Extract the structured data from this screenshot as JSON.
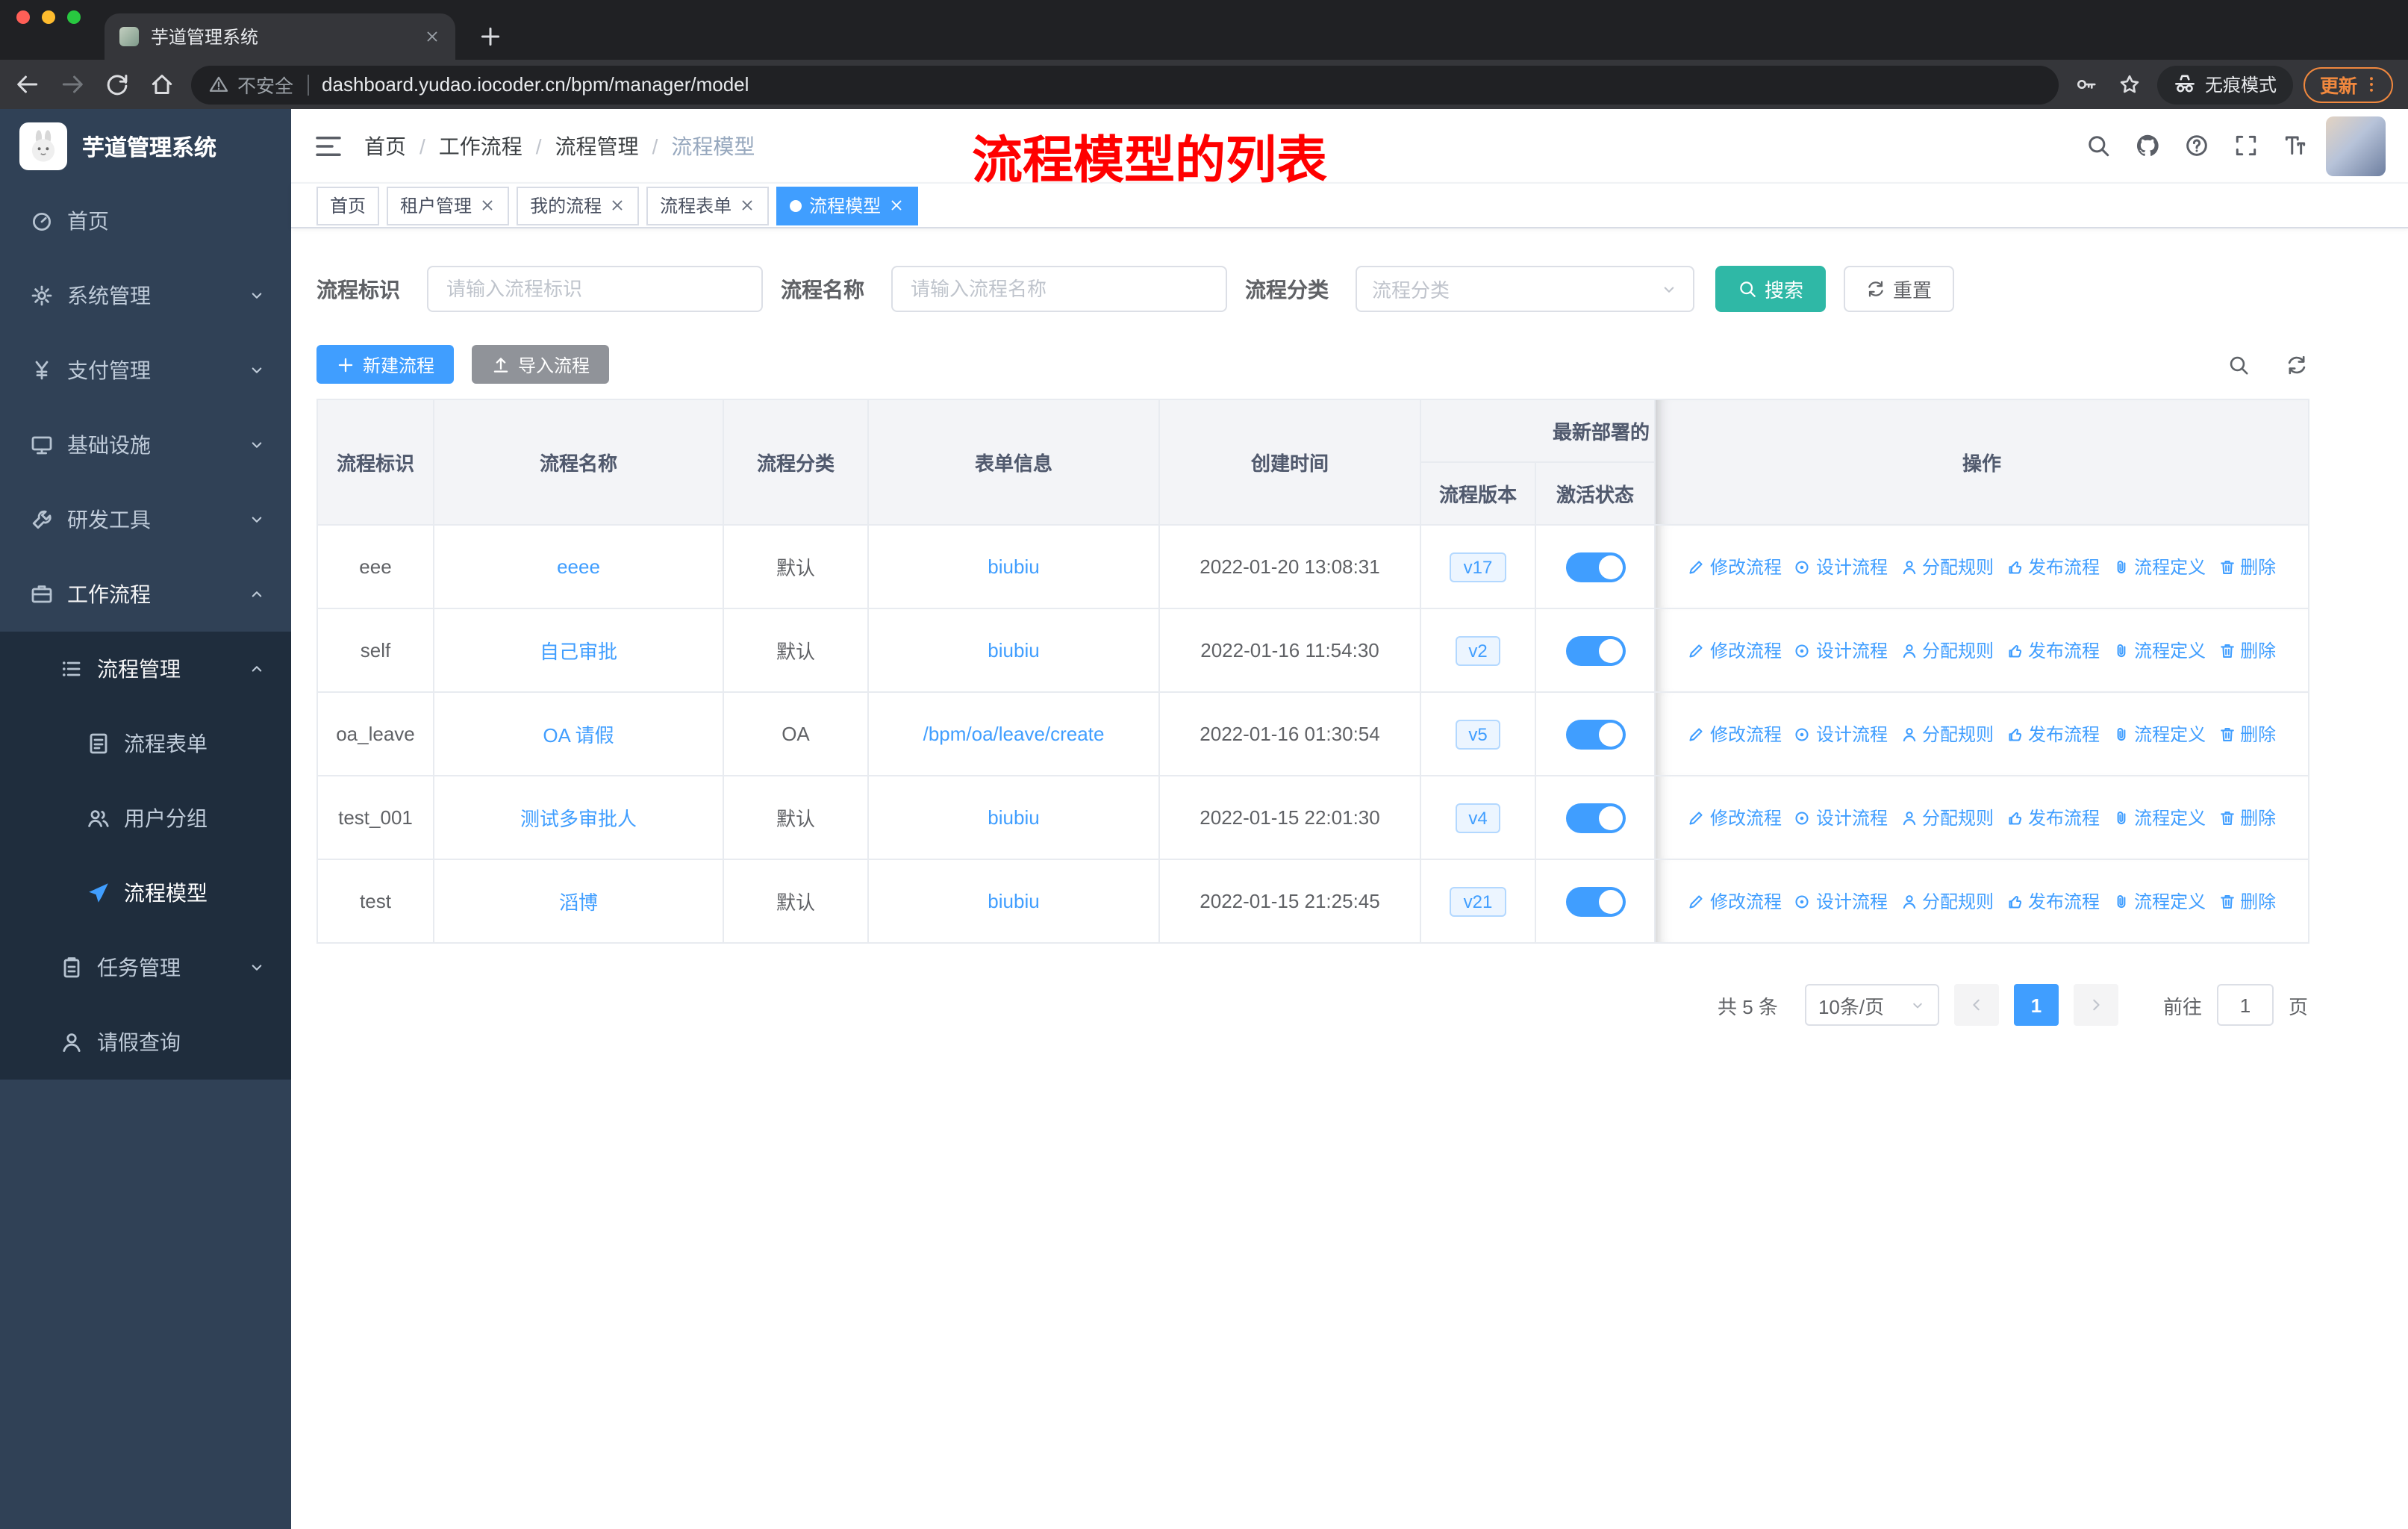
{
  "colors": {
    "primary": "#409eff",
    "search": "#2fb8a6",
    "info": "#909399",
    "sidebar": "#304156",
    "sidebar_dark": "#1f2d3d",
    "annotation": "#ff0000",
    "toggle_on": "#409eff"
  },
  "browser": {
    "tab_title": "芋道管理系统",
    "security_label": "不安全",
    "url": "dashboard.yudao.iocoder.cn/bpm/manager/model",
    "incognito_label": "无痕模式",
    "update_label": "更新",
    "nav_icons": [
      "back-icon",
      "forward-icon",
      "reload-icon",
      "home-icon"
    ],
    "action_icons": [
      "key-icon",
      "star-icon"
    ]
  },
  "sidebar": {
    "title": "芋道管理系统",
    "items": [
      {
        "name": "home",
        "label": "首页",
        "icon": "dashboard-icon",
        "level": 1
      },
      {
        "name": "system-management",
        "label": "系统管理",
        "icon": "gear-icon",
        "level": 1,
        "chevron": "down"
      },
      {
        "name": "payment-management",
        "label": "支付管理",
        "icon": "yen-icon",
        "level": 1,
        "chevron": "down"
      },
      {
        "name": "infrastructure",
        "label": "基础设施",
        "icon": "monitor-icon",
        "level": 1,
        "chevron": "down"
      },
      {
        "name": "dev-tools",
        "label": "研发工具",
        "icon": "wrench-icon",
        "level": 1,
        "chevron": "down"
      },
      {
        "name": "workflow",
        "label": "工作流程",
        "icon": "briefcase-icon",
        "level": 1,
        "chevron": "up",
        "open": true
      },
      {
        "name": "process-management",
        "label": "流程管理",
        "icon": "tree-icon",
        "level": 2,
        "chevron": "up",
        "dark": true,
        "open": true
      },
      {
        "name": "process-form",
        "label": "流程表单",
        "icon": "document-icon",
        "level": 3,
        "dark": true
      },
      {
        "name": "user-group",
        "label": "用户分组",
        "icon": "users-icon",
        "level": 3,
        "dark": true
      },
      {
        "name": "process-model",
        "label": "流程模型",
        "icon": "send-icon",
        "level": 3,
        "dark": true,
        "active": true
      },
      {
        "name": "task-management",
        "label": "任务管理",
        "icon": "clipboard-icon",
        "level": 2,
        "chevron": "down",
        "dark": true
      },
      {
        "name": "leave-query",
        "label": "请假查询",
        "icon": "user-icon",
        "level": 2,
        "dark": true
      }
    ]
  },
  "header": {
    "breadcrumb": [
      "首页",
      "工作流程",
      "流程管理",
      "流程模型"
    ],
    "annotation": "流程模型的列表",
    "icons": [
      "search-icon",
      "github-icon",
      "question-icon",
      "fullscreen-icon",
      "fontsize-icon"
    ]
  },
  "tags": [
    {
      "label": "首页",
      "closable": false,
      "active": false
    },
    {
      "label": "租户管理",
      "closable": true,
      "active": false
    },
    {
      "label": "我的流程",
      "closable": true,
      "active": false
    },
    {
      "label": "流程表单",
      "closable": true,
      "active": false
    },
    {
      "label": "流程模型",
      "closable": true,
      "active": true
    }
  ],
  "filters": {
    "id_label": "流程标识",
    "id_placeholder": "请输入流程标识",
    "name_label": "流程名称",
    "name_placeholder": "请输入流程名称",
    "category_label": "流程分类",
    "category_placeholder": "流程分类",
    "search_label": "搜索",
    "reset_label": "重置"
  },
  "toolbar": {
    "create_label": "新建流程",
    "import_label": "导入流程",
    "tools": [
      "search-icon",
      "refresh-icon"
    ]
  },
  "table": {
    "headers": {
      "process_id": "流程标识",
      "process_name": "流程名称",
      "category": "流程分类",
      "form_info": "表单信息",
      "create_time": "创建时间",
      "deploy_group": "最新部署的",
      "version": "流程版本",
      "status": "激活状态",
      "actions": "操作"
    },
    "rows": [
      {
        "id": "eee",
        "name": "eeee",
        "category": "默认",
        "form": "biubiu",
        "time": "2022-01-20 13:08:31",
        "version": "v17",
        "active": true
      },
      {
        "id": "self",
        "name": "自己审批",
        "category": "默认",
        "form": "biubiu",
        "time": "2022-01-16 11:54:30",
        "version": "v2",
        "active": true
      },
      {
        "id": "oa_leave",
        "name": "OA 请假",
        "category": "OA",
        "form": "/bpm/oa/leave/create",
        "time": "2022-01-16 01:30:54",
        "version": "v5",
        "active": true
      },
      {
        "id": "test_001",
        "name": "测试多审批人",
        "category": "默认",
        "form": "biubiu",
        "time": "2022-01-15 22:01:30",
        "version": "v4",
        "active": true
      },
      {
        "id": "test",
        "name": "滔博",
        "category": "默认",
        "form": "biubiu",
        "time": "2022-01-15 21:25:45",
        "version": "v21",
        "active": true
      }
    ],
    "actions": [
      {
        "name": "modify-process",
        "label": "修改流程",
        "icon": "edit-icon"
      },
      {
        "name": "design-process",
        "label": "设计流程",
        "icon": "design-icon"
      },
      {
        "name": "assign-rule",
        "label": "分配规则",
        "icon": "assign-icon"
      },
      {
        "name": "publish-process",
        "label": "发布流程",
        "icon": "publish-icon"
      },
      {
        "name": "process-definition",
        "label": "流程定义",
        "icon": "link-icon"
      },
      {
        "name": "delete",
        "label": "删除",
        "icon": "trash-icon"
      }
    ]
  },
  "pagination": {
    "total": "共 5 条",
    "page_size": "10条/页",
    "page": "1",
    "goto_label": "前往",
    "goto_value": "1",
    "unit_label": "页"
  }
}
